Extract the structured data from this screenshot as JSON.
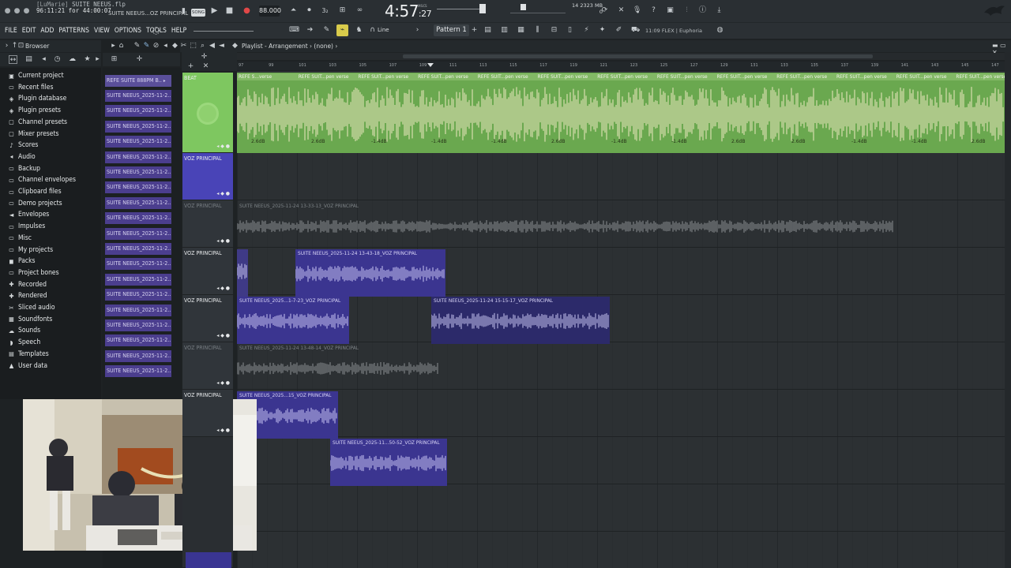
{
  "window": {
    "user": "[LuMarie]",
    "file": "SUITE NEEUS.flp",
    "elapsed": "96:11:21 for 44:00:07",
    "song_name": "SUITE NEEUS...OZ PRINCIPAL",
    "song_mode": "SONG",
    "tempo": "88.000",
    "time_main": "4:57",
    "time_sub": ":27",
    "time_unit": "M:S:CS",
    "cpu": "14",
    "mem_mb": "2323 MB",
    "mem_2": "0"
  },
  "menu": [
    "FILE",
    "EDIT",
    "ADD",
    "PATTERNS",
    "VIEW",
    "OPTIONS",
    "TOOLS",
    "HELP"
  ],
  "toolbar": {
    "snap": "Line",
    "pattern": "Pattern 1",
    "hint_time": "11:09",
    "hint": "FLEX | Euphoria"
  },
  "browser": {
    "title": "Browser",
    "items": [
      {
        "label": "Current project",
        "icon": "project-icon"
      },
      {
        "label": "Recent files",
        "icon": "folder-icon"
      },
      {
        "label": "Plugin database",
        "icon": "plugin-icon"
      },
      {
        "label": "Plugin presets",
        "icon": "plugin-icon"
      },
      {
        "label": "Channel presets",
        "icon": "channel-icon"
      },
      {
        "label": "Mixer presets",
        "icon": "mixer-icon"
      },
      {
        "label": "Scores",
        "icon": "note-icon"
      },
      {
        "label": "Audio",
        "icon": "speaker-icon"
      },
      {
        "label": "Backup",
        "icon": "folder-icon"
      },
      {
        "label": "Channel envelopes",
        "icon": "folder-icon"
      },
      {
        "label": "Clipboard files",
        "icon": "folder-icon"
      },
      {
        "label": "Demo projects",
        "icon": "folder-icon"
      },
      {
        "label": "Envelopes",
        "icon": "envelope-icon"
      },
      {
        "label": "Impulses",
        "icon": "folder-icon"
      },
      {
        "label": "Misc",
        "icon": "folder-icon"
      },
      {
        "label": "My projects",
        "icon": "folder-icon"
      },
      {
        "label": "Packs",
        "icon": "pack-icon"
      },
      {
        "label": "Project bones",
        "icon": "folder-icon"
      },
      {
        "label": "Recorded",
        "icon": "plus-icon"
      },
      {
        "label": "Rendered",
        "icon": "plus-icon"
      },
      {
        "label": "Sliced audio",
        "icon": "slice-icon"
      },
      {
        "label": "Soundfonts",
        "icon": "soundfont-icon"
      },
      {
        "label": "Sounds",
        "icon": "cloud-icon"
      },
      {
        "label": "Speech",
        "icon": "speech-icon"
      },
      {
        "label": "Templates",
        "icon": "template-icon"
      },
      {
        "label": "User data",
        "icon": "user-icon"
      }
    ]
  },
  "picker": {
    "first": "REFE SUITE  888PM B..",
    "clips": [
      "SUITE NEEUS_2025-11-2..",
      "SUITE NEEUS_2025-11-2..",
      "SUITE NEEUS_2025-11-2..",
      "SUITE NEEUS_2025-11-2..",
      "SUITE NEEUS_2025-11-2..",
      "SUITE NEEUS_2025-11-2..",
      "SUITE NEEUS_2025-11-2..",
      "SUITE NEEUS_2025-11-2..",
      "SUITE NEEUS_2025-11-2..",
      "SUITE NEEUS_2025-11-2..",
      "SUITE NEEUS_2025-11-2..",
      "SUITE NEEUS_2025-11-2..",
      "SUITE NEEUS_2025-11-2..",
      "SUITE NEEUS_2025-11-2..",
      "SUITE NEEUS_2025-11-2..",
      "SUITE NEEUS_2025-11-2..",
      "SUITE NEEUS_2025-11-2..",
      "SUITE NEEUS_2025-11-2..",
      "SUITE NEEUS_2025-11-2.."
    ]
  },
  "playlist": {
    "title": "Playlist - Arrangement",
    "separator": "›",
    "pattern": "(none)",
    "ruler": [
      "97",
      "99",
      "101",
      "103",
      "105",
      "107",
      "109",
      "111",
      "113",
      "115",
      "117",
      "119",
      "121",
      "123",
      "125",
      "127",
      "129",
      "131",
      "133",
      "135",
      "137",
      "139",
      "141",
      "143",
      "145",
      "147"
    ],
    "beat_clips": [
      "REFE S...verse",
      "REFE SUIT...pen verse",
      "REFE SUIT...pen verse",
      "REFE SUIT...pen verse",
      "REFE SUIT...pen verse",
      "REFE SUIT...pen verse",
      "REFE SUIT...pen verse",
      "REFE SUIT...pen verse",
      "REFE SUIT...pen verse",
      "REFE SUIT...pen verse",
      "REFE SUIT...pen verse",
      "REFE SUIT...pen verse",
      "REFE SUIT...pen verse"
    ],
    "db_labels": [
      "2.6dB",
      "2.6dB",
      "-1.4dB",
      "-1.4dB",
      "-1.4dB",
      "2.6dB",
      "-1.4dB",
      "-1.4dB",
      "2.6dB",
      "2.6dB",
      "-1.4dB",
      "-1.4dB",
      "2.6dB"
    ],
    "tracks": [
      {
        "name": "BEAT"
      },
      {
        "name": "VOZ PRINCIPAL"
      },
      {
        "name": "VOZ PRINCIPAL"
      },
      {
        "name": "VOZ PRINCIPAL"
      },
      {
        "name": "VOZ PRINCIPAL"
      },
      {
        "name": "VOZ PRINCIPAL"
      },
      {
        "name": "VOZ PRINCIPAL"
      }
    ],
    "audio_clips": [
      {
        "label": "SUITE NEEUS_2025-11-24 13-33-13_VOZ PRINCIPAL"
      },
      {
        "label": "SUITE NEEUS_2025-11-24 13-43-18_VOZ PRINCIPAL"
      },
      {
        "label": "SUITE NEEUS_2025...1-7-23_VOZ PRINCIPAL"
      },
      {
        "label": "SUITE NEEUS_2025-11-24 15-15-17_VOZ PRINCIPAL"
      },
      {
        "label": "SUITE NEEUS_2025-11-24 13-48-14_VOZ PRINCIPAL"
      },
      {
        "label": "SUITE NEEUS_2025...15_VOZ PRINCIPAL"
      },
      {
        "label": "SUITE NEEUS_2025-11...50-52_VOZ PRINCIPAL"
      }
    ]
  },
  "colors": {
    "beat": "#6aa84f",
    "beat_wave": "#efe9c2",
    "voice": "#3c3693",
    "voice_wave": "#c9c5f3",
    "muted_wave": "#8b8f93",
    "highlight": "#d9cb4b"
  }
}
